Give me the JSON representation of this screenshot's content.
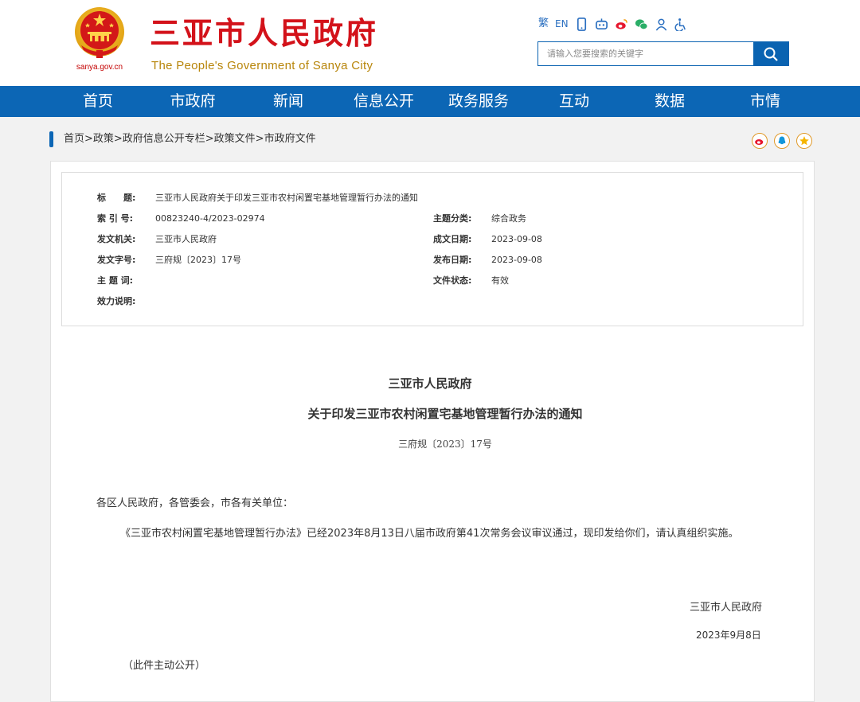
{
  "header": {
    "logo_cn": "三亚市人民政府",
    "logo_en": "The People's Government of Sanya City",
    "domain": "sanya.gov.cn",
    "toolbar": {
      "traditional": "繁",
      "english": "EN"
    },
    "search": {
      "placeholder": "请输入您要搜索的关键字"
    }
  },
  "nav": [
    "首页",
    "市政府",
    "新闻",
    "信息公开",
    "政务服务",
    "互动",
    "数据",
    "市情"
  ],
  "breadcrumb": "首页>政策>政府信息公开专栏>政策文件>市政府文件",
  "meta": {
    "title_label": "标　　题:",
    "title_value": "三亚市人民政府关于印发三亚市农村闲置宅基地管理暂行办法的通知",
    "index_label": "索 引 号:",
    "index_value": "00823240-4/2023-02974",
    "category_label": "主题分类:",
    "category_value": "综合政务",
    "issuer_label": "发文机关:",
    "issuer_value": "三亚市人民政府",
    "written_label": "成文日期:",
    "written_value": "2023-09-08",
    "docno_label": "发文字号:",
    "docno_value": "三府规〔2023〕17号",
    "publish_label": "发布日期:",
    "publish_value": "2023-09-08",
    "keywords_label": "主 题 词:",
    "keywords_value": "",
    "status_label": "文件状态:",
    "status_value": "有效",
    "validity_label": "效力说明:",
    "validity_value": ""
  },
  "doc": {
    "issuer": "三亚市人民政府",
    "title": "关于印发三亚市农村闲置宅基地管理暂行办法的通知",
    "number": "三府规〔2023〕17号",
    "salutation": "各区人民政府，各管委会，市各有关单位：",
    "body": "《三亚市农村闲置宅基地管理暂行办法》已经2023年8月13日八届市政府第41次常务会议审议通过，现印发给你们，请认真组织实施。",
    "sign_org": "三亚市人民政府",
    "sign_date": "2023年9月8日",
    "note": "（此件主动公开）"
  },
  "colors": {
    "brand_red": "#d3121a",
    "nav_blue": "#0c66b5",
    "gold": "#b8860b"
  },
  "icons": [
    "emblem-icon",
    "mobile-icon",
    "robot-icon",
    "weibo-icon",
    "wechat-icon",
    "user-icon",
    "accessibility-icon",
    "search-icon",
    "share-weibo-icon",
    "share-qq-icon",
    "favorite-icon"
  ]
}
